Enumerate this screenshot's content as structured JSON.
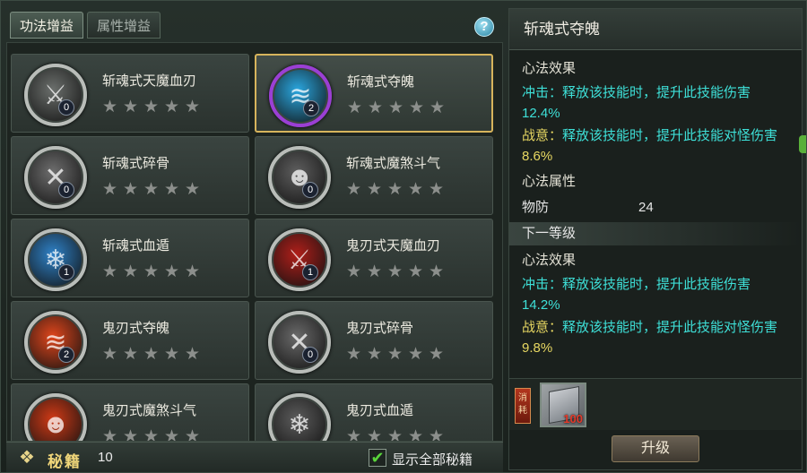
{
  "tabs": [
    {
      "label": "功法增益",
      "active": true
    },
    {
      "label": "属性增益",
      "active": false
    }
  ],
  "help": "?",
  "cards": [
    {
      "name": "斩魂式天魔血刃",
      "level": "0",
      "icon": "blade-icon",
      "color": "#6b6f6c",
      "selected": false
    },
    {
      "name": "斩魂式夺魄",
      "level": "2",
      "icon": "claw-icon",
      "color": "#2aa7e0",
      "ring": "#9b3fd4",
      "selected": true
    },
    {
      "name": "斩魂式碎骨",
      "level": "0",
      "icon": "bone-icon",
      "color": "#6e6e6e",
      "selected": false
    },
    {
      "name": "斩魂式魔煞斗气",
      "level": "0",
      "icon": "demon-face-icon",
      "color": "#5e5e5e",
      "selected": false
    },
    {
      "name": "斩魂式血遁",
      "level": "1",
      "icon": "ice-flame-icon",
      "color": "#2f82c8",
      "selected": false
    },
    {
      "name": "鬼刃式天魔血刃",
      "level": "1",
      "icon": "blade-icon",
      "color": "#b01f1a",
      "selected": false
    },
    {
      "name": "鬼刃式夺魄",
      "level": "2",
      "icon": "claw-icon",
      "color": "#e0461c",
      "selected": false
    },
    {
      "name": "鬼刃式碎骨",
      "level": "0",
      "icon": "bone-icon",
      "color": "#6a6a6a",
      "selected": false
    },
    {
      "name": "鬼刃式魔煞斗气",
      "level": "",
      "icon": "demon-face-icon",
      "color": "#d03a16",
      "selected": false
    },
    {
      "name": "鬼刃式血遁",
      "level": "",
      "icon": "ice-flame-icon",
      "color": "#5c5c5c",
      "selected": false
    }
  ],
  "stars_per_card": 5,
  "bottom": {
    "label": "秘籍",
    "count": "10",
    "checkbox_label": "显示全部秘籍",
    "checked": true
  },
  "detail": {
    "title": "斩魂式夺魄",
    "current_header": "心法效果",
    "current_effects": [
      {
        "name": "冲击：",
        "text": "释放该技能时，提升此技能伤害",
        "value": "12.4%",
        "color": "#3ee0d8"
      },
      {
        "name": "战意：",
        "text": "释放该技能时，提升此技能对怪伤害",
        "value": "8.6%",
        "color": "#e8d862"
      }
    ],
    "attr_header": "心法属性",
    "attr_name": "物防",
    "attr_value": "24",
    "next_label": "下一等级",
    "next_header": "心法效果",
    "next_effects": [
      {
        "name": "冲击：",
        "text": "释放该技能时，提升此技能伤害",
        "value": "14.2%",
        "color": "#3ee0d8"
      },
      {
        "name": "战意：",
        "text": "释放该技能时，提升此技能对怪伤害",
        "value": "9.8%",
        "color": "#e8d862"
      }
    ],
    "cost_tag": "消耗",
    "cost_qty": "100",
    "upgrade_label": "升级"
  }
}
